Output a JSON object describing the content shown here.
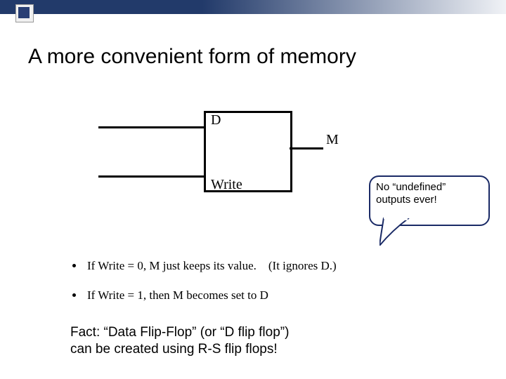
{
  "title": "A more convenient form of memory",
  "diagram": {
    "labels": {
      "d": "D",
      "write": "Write",
      "m": "M"
    }
  },
  "callout": {
    "line1": "No “undefined”",
    "line2": "outputs ever!"
  },
  "bullets": {
    "b1_pre": "If Write = 0, M just keeps its value.",
    "b1_paren": "(It ignores D.)",
    "b2": "If Write = 1, then M becomes set to D"
  },
  "fact": {
    "line1": "Fact: “Data Flip-Flop” (or “D flip flop”)",
    "line2": "can be created using R-S flip flops!"
  }
}
